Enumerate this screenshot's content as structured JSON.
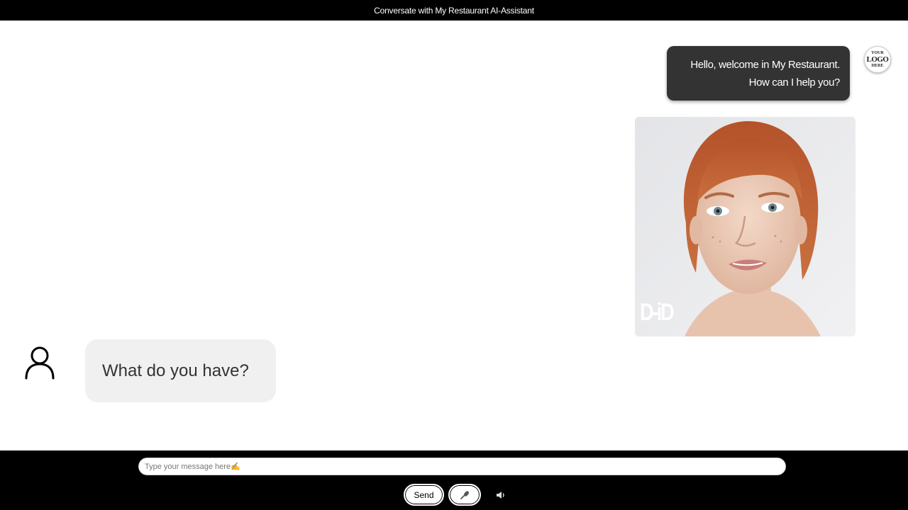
{
  "header": {
    "title": "Conversate with My Restaurant AI-Assistant"
  },
  "chat": {
    "bot_message": {
      "line1": "Hello, welcome in My Restaurant.",
      "line2": "How can I help you?"
    },
    "logo": {
      "line1": "YOUR",
      "line2": "LOGO",
      "line3": "HERE"
    },
    "avatar_watermark": "D-iD",
    "user_message": "What do you have?"
  },
  "composer": {
    "placeholder": "Type your message here✍️",
    "send_label": "Send",
    "mic_icon": "microphone-icon",
    "speaker_icon": "speaker-icon"
  },
  "colors": {
    "bars": "#000000",
    "bot_bubble": "#333333",
    "user_bubble": "#f0f0f0",
    "background": "#ffffff"
  }
}
